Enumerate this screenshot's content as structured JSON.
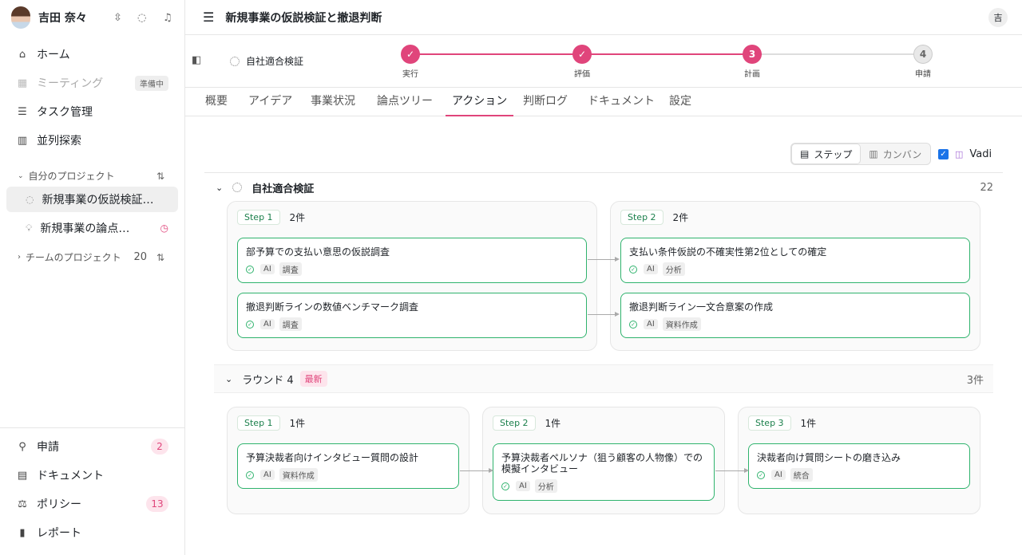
{
  "user": {
    "name": "吉田 奈々",
    "initial": "吉"
  },
  "sidebar": {
    "nav": [
      {
        "label": "ホーム",
        "icon": "home-icon"
      },
      {
        "label": "ミーティング",
        "icon": "calendar-icon",
        "pill": "準備中"
      },
      {
        "label": "タスク管理",
        "icon": "task-list-icon"
      },
      {
        "label": "並列探索",
        "icon": "columns-icon"
      }
    ],
    "my_projects_label": "自分のプロジェクト",
    "my_projects": [
      {
        "label": "新規事業の仮説検証…"
      },
      {
        "label": "新規事業の論点…"
      }
    ],
    "team_projects_label": "チームのプロジェクト",
    "team_projects_count": "20",
    "bottom": [
      {
        "label": "申請",
        "badge": "2"
      },
      {
        "label": "ドキュメント"
      },
      {
        "label": "ポリシー",
        "badge": "13"
      },
      {
        "label": "レポート"
      }
    ]
  },
  "header": {
    "title": "新規事業の仮説検証と撤退判断"
  },
  "progress": {
    "status_label": "自社適合検証",
    "steps": [
      {
        "label": "実行",
        "mark": "✓"
      },
      {
        "label": "評価",
        "mark": "✓"
      },
      {
        "label": "計画",
        "mark": "3"
      },
      {
        "label": "申請",
        "mark": "4"
      }
    ]
  },
  "tabs": [
    "概要",
    "アイデア",
    "事業状況",
    "論点ツリー",
    "アクション",
    "判断ログ",
    "ドキュメント",
    "設定"
  ],
  "toolbar": {
    "step_label": "ステップ",
    "kanban_label": "カンバン",
    "vadi_label": "Vadi"
  },
  "group1": {
    "title": "自社適合検証",
    "count": "22",
    "steps": [
      {
        "tag": "Step 1",
        "count": "2件",
        "cards": [
          {
            "title": "部予算での支払い意思の仮説調査",
            "ai": "AI",
            "tag": "調査"
          },
          {
            "title": "撤退判断ラインの数値ベンチマーク調査",
            "ai": "AI",
            "tag": "調査"
          }
        ]
      },
      {
        "tag": "Step 2",
        "count": "2件",
        "cards": [
          {
            "title": "支払い条件仮説の不確実性第2位としての確定",
            "ai": "AI",
            "tag": "分析"
          },
          {
            "title": "撤退判断ライン一文合意案の作成",
            "ai": "AI",
            "tag": "資料作成"
          }
        ]
      }
    ]
  },
  "group2": {
    "title": "ラウンド 4",
    "new_label": "最新",
    "count": "3件",
    "steps": [
      {
        "tag": "Step 1",
        "count": "1件",
        "cards": [
          {
            "title": "予算決裁者向けインタビュー質問の設計",
            "ai": "AI",
            "tag": "資料作成"
          }
        ]
      },
      {
        "tag": "Step 2",
        "count": "1件",
        "cards": [
          {
            "title": "予算決裁者ペルソナ（狙う顧客の人物像）での模擬インタビュー",
            "ai": "AI",
            "tag": "分析"
          }
        ]
      },
      {
        "tag": "Step 3",
        "count": "1件",
        "cards": [
          {
            "title": "決裁者向け質問シートの磨き込み",
            "ai": "AI",
            "tag": "統合"
          }
        ]
      }
    ]
  }
}
